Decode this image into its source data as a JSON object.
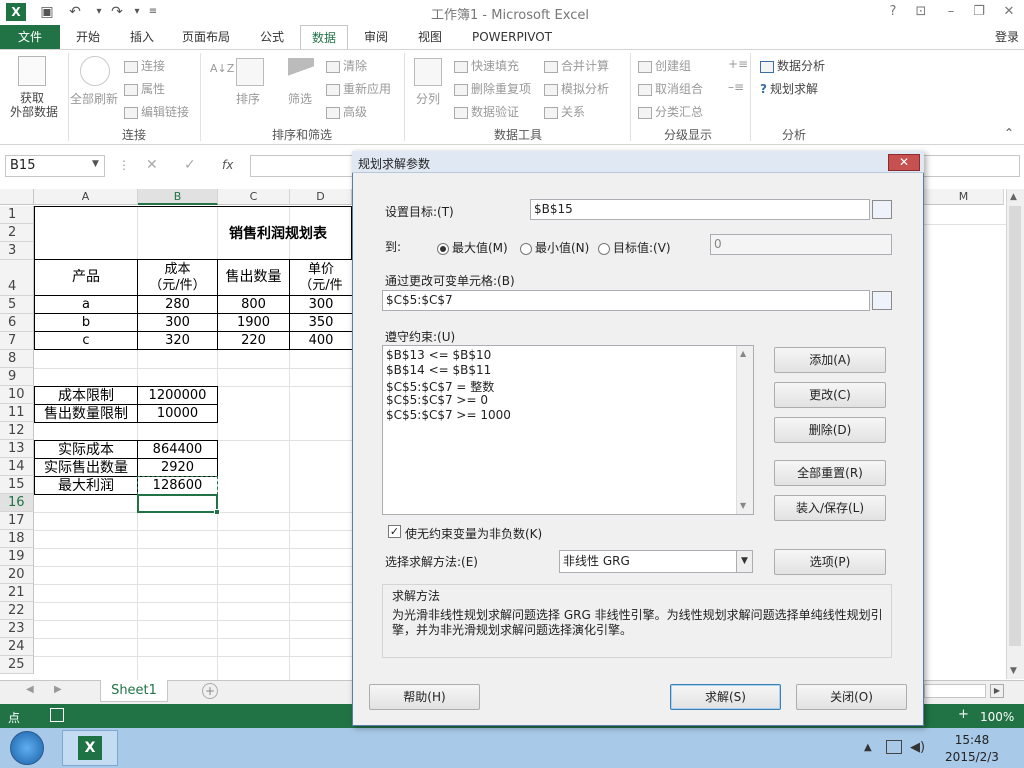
{
  "app": {
    "title": "工作簿1 - Microsoft Excel",
    "icon": "X",
    "window_buttons": [
      "?",
      "⊡",
      "–",
      "❐",
      "✕"
    ],
    "signin": "登录"
  },
  "tabs": [
    "文件",
    "开始",
    "插入",
    "页面布局",
    "公式",
    "数据",
    "审阅",
    "视图",
    "POWERPIVOT"
  ],
  "ribbon": {
    "get_external_1": "获取",
    "get_external_2": "外部数据",
    "refresh_all": "全部刷新",
    "connections": "连接",
    "properties": "属性",
    "edit_links": "编辑链接",
    "group_connections": "连接",
    "sort_az": "A↓Z",
    "sort": "排序",
    "filter": "筛选",
    "clear": "清除",
    "reapply": "重新应用",
    "advanced": "高级",
    "group_sort": "排序和筛选",
    "split": "分列",
    "flash_fill": "快速填充",
    "remove_dup": "删除重复项",
    "validation": "数据验证",
    "consolidate": "合并计算",
    "whatif": "模拟分析",
    "relations": "关系",
    "group_tools": "数据工具",
    "group_create": "创建组",
    "ungroup": "取消组合",
    "subtotal": "分类汇总",
    "group_outline": "分级显示",
    "data_analysis": "数据分析",
    "solver": "规划求解",
    "group_analysis": "分析"
  },
  "formula": {
    "namebox": "B15",
    "fx": "fx"
  },
  "columns": [
    "A",
    "B",
    "C",
    "D",
    "M"
  ],
  "rows": [
    "1",
    "2",
    "3",
    "4",
    "5",
    "6",
    "7",
    "8",
    "9",
    "10",
    "11",
    "12",
    "13",
    "14",
    "15",
    "16",
    "17",
    "18",
    "19",
    "20",
    "21",
    "22",
    "23",
    "24",
    "25"
  ],
  "sheet": {
    "title": "销售利润规划表",
    "h_product": "产品",
    "h_cost_1": "成本",
    "h_cost_2": "（元/件）",
    "h_qty": "售出数量",
    "h_price_1": "单价",
    "h_price_2": "（元/件",
    "r5": [
      "a",
      "280",
      "800",
      "300"
    ],
    "r6": [
      "b",
      "300",
      "1900",
      "350"
    ],
    "r7": [
      "c",
      "320",
      "220",
      "400"
    ],
    "cost_limit_label": "成本限制",
    "cost_limit": "1200000",
    "qty_limit_label": "售出数量限制",
    "qty_limit": "10000",
    "actual_cost_label": "实际成本",
    "actual_cost": "864400",
    "actual_qty_label": "实际售出数量",
    "actual_qty": "2920",
    "max_profit_label": "最大利润",
    "max_profit": "128600"
  },
  "sheet_tab": "Sheet1",
  "status": {
    "mode": "点",
    "zoom": "100%"
  },
  "taskbar": {
    "time": "15:48",
    "date": "2015/2/3"
  },
  "dialog": {
    "title": "规划求解参数",
    "set_objective_label": "设置目标:(T)",
    "objective": "$B$15",
    "to_label": "到:",
    "opt_max": "最大值(M)",
    "opt_min": "最小值(N)",
    "opt_value": "目标值:(V)",
    "value": "0",
    "changing_label": "通过更改可变单元格:(B)",
    "changing": "$C$5:$C$7",
    "constraints_label": "遵守约束:(U)",
    "constraints": [
      "$B$13 <= $B$10",
      "$B$14 <= $B$11",
      "$C$5:$C$7 = 整数",
      "$C$5:$C$7 >= 0",
      "$C$5:$C$7 >= 1000"
    ],
    "btn_add": "添加(A)",
    "btn_change": "更改(C)",
    "btn_delete": "删除(D)",
    "btn_reset": "全部重置(R)",
    "btn_load": "装入/保存(L)",
    "nonneg_label": "使无约束变量为非负数(K)",
    "method_label": "选择求解方法:(E)",
    "method": "非线性 GRG",
    "btn_options": "选项(P)",
    "method_group_title": "求解方法",
    "method_desc": "为光滑非线性规划求解问题选择 GRG 非线性引擎。为线性规划求解问题选择单纯线性规划引擎，并为非光滑规划求解问题选择演化引擎。",
    "btn_help": "帮助(H)",
    "btn_solve": "求解(S)",
    "btn_close": "关闭(O)"
  }
}
